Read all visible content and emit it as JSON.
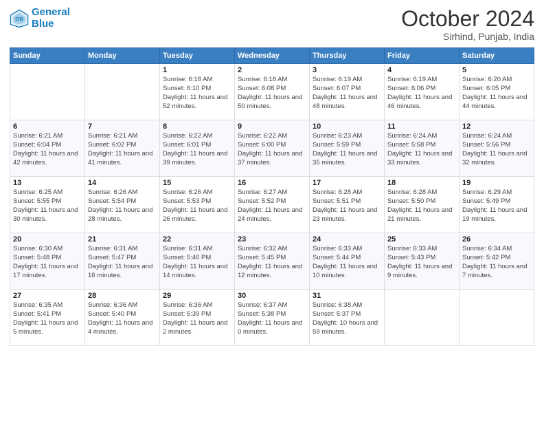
{
  "header": {
    "logo_line1": "General",
    "logo_line2": "Blue",
    "month": "October 2024",
    "location": "Sirhind, Punjab, India"
  },
  "weekdays": [
    "Sunday",
    "Monday",
    "Tuesday",
    "Wednesday",
    "Thursday",
    "Friday",
    "Saturday"
  ],
  "weeks": [
    [
      {
        "day": "",
        "info": ""
      },
      {
        "day": "",
        "info": ""
      },
      {
        "day": "1",
        "info": "Sunrise: 6:18 AM\nSunset: 6:10 PM\nDaylight: 11 hours and 52 minutes."
      },
      {
        "day": "2",
        "info": "Sunrise: 6:18 AM\nSunset: 6:08 PM\nDaylight: 11 hours and 50 minutes."
      },
      {
        "day": "3",
        "info": "Sunrise: 6:19 AM\nSunset: 6:07 PM\nDaylight: 11 hours and 48 minutes."
      },
      {
        "day": "4",
        "info": "Sunrise: 6:19 AM\nSunset: 6:06 PM\nDaylight: 11 hours and 46 minutes."
      },
      {
        "day": "5",
        "info": "Sunrise: 6:20 AM\nSunset: 6:05 PM\nDaylight: 11 hours and 44 minutes."
      }
    ],
    [
      {
        "day": "6",
        "info": "Sunrise: 6:21 AM\nSunset: 6:04 PM\nDaylight: 11 hours and 42 minutes."
      },
      {
        "day": "7",
        "info": "Sunrise: 6:21 AM\nSunset: 6:02 PM\nDaylight: 11 hours and 41 minutes."
      },
      {
        "day": "8",
        "info": "Sunrise: 6:22 AM\nSunset: 6:01 PM\nDaylight: 11 hours and 39 minutes."
      },
      {
        "day": "9",
        "info": "Sunrise: 6:22 AM\nSunset: 6:00 PM\nDaylight: 11 hours and 37 minutes."
      },
      {
        "day": "10",
        "info": "Sunrise: 6:23 AM\nSunset: 5:59 PM\nDaylight: 11 hours and 35 minutes."
      },
      {
        "day": "11",
        "info": "Sunrise: 6:24 AM\nSunset: 5:58 PM\nDaylight: 11 hours and 33 minutes."
      },
      {
        "day": "12",
        "info": "Sunrise: 6:24 AM\nSunset: 5:56 PM\nDaylight: 11 hours and 32 minutes."
      }
    ],
    [
      {
        "day": "13",
        "info": "Sunrise: 6:25 AM\nSunset: 5:55 PM\nDaylight: 11 hours and 30 minutes."
      },
      {
        "day": "14",
        "info": "Sunrise: 6:26 AM\nSunset: 5:54 PM\nDaylight: 11 hours and 28 minutes."
      },
      {
        "day": "15",
        "info": "Sunrise: 6:26 AM\nSunset: 5:53 PM\nDaylight: 11 hours and 26 minutes."
      },
      {
        "day": "16",
        "info": "Sunrise: 6:27 AM\nSunset: 5:52 PM\nDaylight: 11 hours and 24 minutes."
      },
      {
        "day": "17",
        "info": "Sunrise: 6:28 AM\nSunset: 5:51 PM\nDaylight: 11 hours and 23 minutes."
      },
      {
        "day": "18",
        "info": "Sunrise: 6:28 AM\nSunset: 5:50 PM\nDaylight: 11 hours and 21 minutes."
      },
      {
        "day": "19",
        "info": "Sunrise: 6:29 AM\nSunset: 5:49 PM\nDaylight: 11 hours and 19 minutes."
      }
    ],
    [
      {
        "day": "20",
        "info": "Sunrise: 6:30 AM\nSunset: 5:48 PM\nDaylight: 11 hours and 17 minutes."
      },
      {
        "day": "21",
        "info": "Sunrise: 6:31 AM\nSunset: 5:47 PM\nDaylight: 11 hours and 16 minutes."
      },
      {
        "day": "22",
        "info": "Sunrise: 6:31 AM\nSunset: 5:46 PM\nDaylight: 11 hours and 14 minutes."
      },
      {
        "day": "23",
        "info": "Sunrise: 6:32 AM\nSunset: 5:45 PM\nDaylight: 11 hours and 12 minutes."
      },
      {
        "day": "24",
        "info": "Sunrise: 6:33 AM\nSunset: 5:44 PM\nDaylight: 11 hours and 10 minutes."
      },
      {
        "day": "25",
        "info": "Sunrise: 6:33 AM\nSunset: 5:43 PM\nDaylight: 11 hours and 9 minutes."
      },
      {
        "day": "26",
        "info": "Sunrise: 6:34 AM\nSunset: 5:42 PM\nDaylight: 11 hours and 7 minutes."
      }
    ],
    [
      {
        "day": "27",
        "info": "Sunrise: 6:35 AM\nSunset: 5:41 PM\nDaylight: 11 hours and 5 minutes."
      },
      {
        "day": "28",
        "info": "Sunrise: 6:36 AM\nSunset: 5:40 PM\nDaylight: 11 hours and 4 minutes."
      },
      {
        "day": "29",
        "info": "Sunrise: 6:36 AM\nSunset: 5:39 PM\nDaylight: 11 hours and 2 minutes."
      },
      {
        "day": "30",
        "info": "Sunrise: 6:37 AM\nSunset: 5:38 PM\nDaylight: 11 hours and 0 minutes."
      },
      {
        "day": "31",
        "info": "Sunrise: 6:38 AM\nSunset: 5:37 PM\nDaylight: 10 hours and 59 minutes."
      },
      {
        "day": "",
        "info": ""
      },
      {
        "day": "",
        "info": ""
      }
    ]
  ]
}
